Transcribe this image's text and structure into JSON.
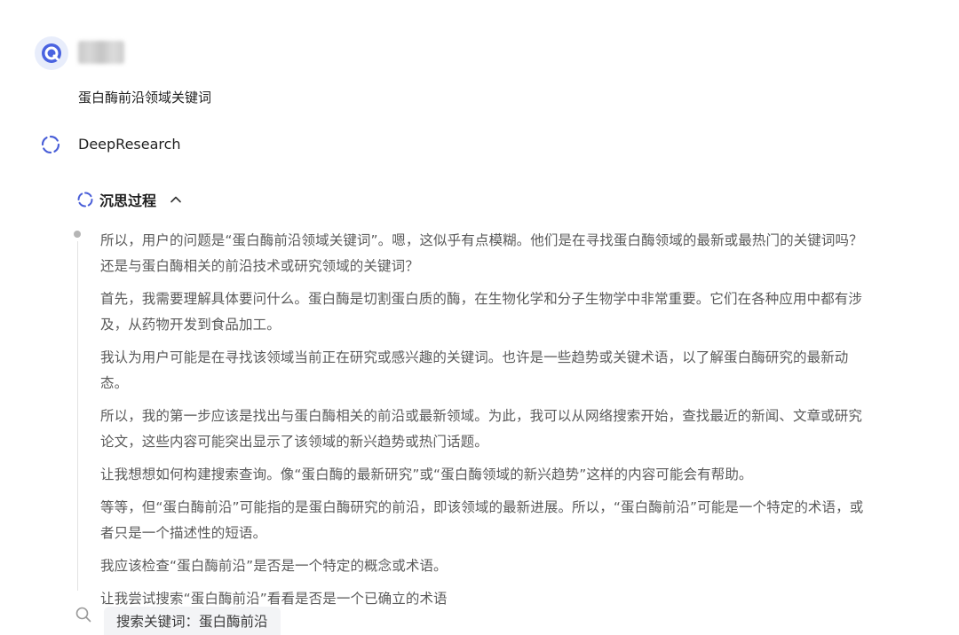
{
  "user": {
    "avatar_icon": "assistant-logo-icon",
    "question": "蛋白酶前沿领域关键词"
  },
  "assistant": {
    "icon": "loading-ring-icon",
    "name": "DeepResearch"
  },
  "thinking": {
    "title": "沉思过程",
    "toggle_icon": "chevron-up-icon",
    "paragraphs": [
      "所以，用户的问题是“蛋白酶前沿领域关键词”。嗯，这似乎有点模糊。他们是在寻找蛋白酶领域的最新或最热门的关键词吗？还是与蛋白酶相关的前沿技术或研究领域的关键词？",
      "首先，我需要理解具体要问什么。蛋白酶是切割蛋白质的酶，在生物化学和分子生物学中非常重要。它们在各种应用中都有涉及，从药物开发到食品加工。",
      "我认为用户可能是在寻找该领域当前正在研究或感兴趣的关键词。也许是一些趋势或关键术语，以了解蛋白酶研究的最新动态。",
      "所以，我的第一步应该是找出与蛋白酶相关的前沿或最新领域。为此，我可以从网络搜索开始，查找最近的新闻、文章或研究论文，这些内容可能突出显示了该领域的新兴趋势或热门话题。",
      "让我想想如何构建搜索查询。像“蛋白酶的最新研究”或“蛋白酶领域的新兴趋势”这样的内容可能会有帮助。",
      "等等，但“蛋白酶前沿”可能指的是蛋白酶研究的前沿，即该领域的最新进展。所以，“蛋白酶前沿”可能是一个特定的术语，或者只是一个描述性的短语。",
      "我应该检查“蛋白酶前沿”是否是一个特定的概念或术语。",
      "让我尝试搜索“蛋白酶前沿”看看是否是一个已确立的术语"
    ]
  },
  "search_step": {
    "icon": "search-icon",
    "label": "搜索关键词：蛋白酶前沿"
  },
  "colors": {
    "accent": "#3b5bdb",
    "text": "#1f1f1f",
    "muted_text": "#5a5a5a",
    "chip_bg": "#f3f4f6"
  }
}
